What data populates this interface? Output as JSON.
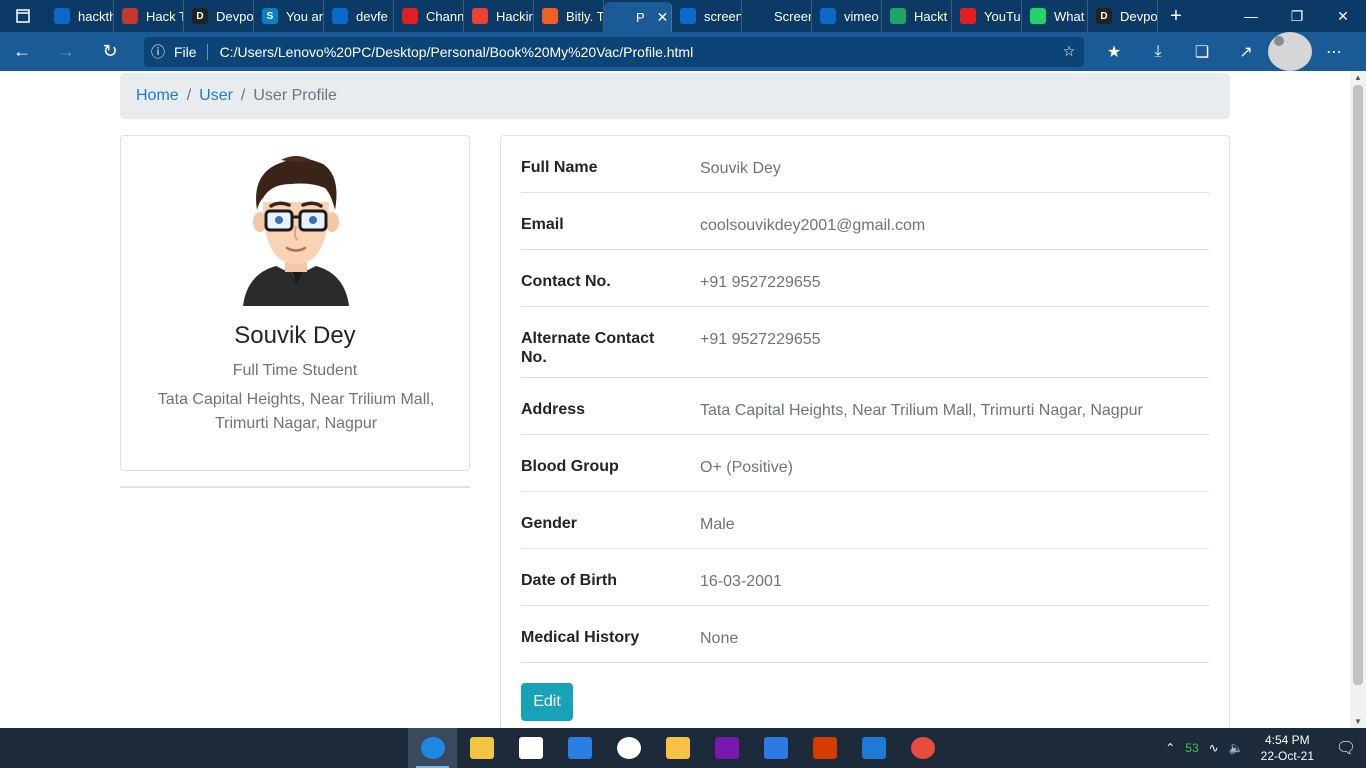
{
  "browser": {
    "tabs": [
      {
        "title": "hackth",
        "favicon": "bing",
        "color": "#0b6ac9",
        "active": false
      },
      {
        "title": "Hack T",
        "favicon": "avatar-round",
        "color": "#c0392b",
        "active": false
      },
      {
        "title": "Devpo",
        "favicon": "D",
        "color": "#222222",
        "active": false
      },
      {
        "title": "You ar",
        "favicon": "S",
        "color": "#0a7fc5",
        "active": false
      },
      {
        "title": "devfe",
        "favicon": "bing",
        "color": "#0b6ac9",
        "active": false
      },
      {
        "title": "Chann",
        "favicon": "youtube",
        "color": "#e02020",
        "active": false
      },
      {
        "title": "Hackir",
        "favicon": "gmail",
        "color": "#ea4335",
        "active": false
      },
      {
        "title": "Bitly. T",
        "favicon": "bitly",
        "color": "#ee6123",
        "active": false
      },
      {
        "title": "P",
        "favicon": "page",
        "color": "#1a5a96",
        "active": true
      },
      {
        "title": "screen",
        "favicon": "bing",
        "color": "#0b6ac9",
        "active": false
      },
      {
        "title": "Screer",
        "favicon": "page",
        "color": "#0b3a66",
        "active": false
      },
      {
        "title": "vimeo",
        "favicon": "bing",
        "color": "#0b6ac9",
        "active": false
      },
      {
        "title": "Hackt",
        "favicon": "drive",
        "color": "#1fa463",
        "active": false
      },
      {
        "title": "YouTu",
        "favicon": "youtube",
        "color": "#e02020",
        "active": false
      },
      {
        "title": "What",
        "favicon": "whatsapp",
        "color": "#25d366",
        "active": false
      },
      {
        "title": "Devpo",
        "favicon": "D",
        "color": "#222222",
        "active": false
      }
    ],
    "address": {
      "scheme": "File",
      "url": "C:/Users/Lenovo%20PC/Desktop/Personal/Book%20My%20Vac/Profile.html"
    }
  },
  "breadcrumb": {
    "home": "Home",
    "user": "User",
    "current": "User Profile",
    "separator": "/"
  },
  "profile": {
    "name": "Souvik Dey",
    "role": "Full Time Student",
    "address": "Tata Capital Heights, Near Trilium Mall, Trimurti Nagar, Nagpur"
  },
  "details": [
    {
      "label": "Full Name",
      "value": "Souvik Dey"
    },
    {
      "label": "Email",
      "value": "coolsouvikdey2001@gmail.com"
    },
    {
      "label": "Contact No.",
      "value": "+91 9527229655"
    },
    {
      "label": "Alternate Contact No.",
      "value": "+91 9527229655"
    },
    {
      "label": "Address",
      "value": "Tata Capital Heights, Near Trilium Mall, Trimurti Nagar, Nagpur"
    },
    {
      "label": "Blood Group",
      "value": "O+ (Positive)"
    },
    {
      "label": "Gender",
      "value": "Male"
    },
    {
      "label": "Date of Birth",
      "value": "16-03-2001"
    },
    {
      "label": "Medical History",
      "value": "None"
    }
  ],
  "actions": {
    "edit_label": "Edit",
    "edit_color": "#17a2b8"
  },
  "taskbar": {
    "apps": [
      {
        "name": "edge-icon",
        "color": "#1e88e5",
        "active": true
      },
      {
        "name": "file-explorer-icon",
        "color": "#f4c542",
        "active": false
      },
      {
        "name": "store-icon",
        "color": "#ffffff",
        "active": false
      },
      {
        "name": "mail-icon",
        "color": "#2a7de1",
        "active": false
      },
      {
        "name": "settings-icon",
        "color": "#ffffff",
        "active": false
      },
      {
        "name": "sticky-notes-icon",
        "color": "#f6c344",
        "active": false
      },
      {
        "name": "onenote-icon",
        "color": "#7719aa",
        "active": false
      },
      {
        "name": "todo-icon",
        "color": "#2c7be5",
        "active": false
      },
      {
        "name": "office-icon",
        "color": "#d83b01",
        "active": false
      },
      {
        "name": "photos-icon",
        "color": "#1f7ad6",
        "active": false
      },
      {
        "name": "screen-recorder-icon",
        "color": "#e74c3c",
        "active": false
      }
    ],
    "tray": {
      "temperature": "53",
      "time": "4:54 PM",
      "date": "22-Oct-21"
    }
  }
}
